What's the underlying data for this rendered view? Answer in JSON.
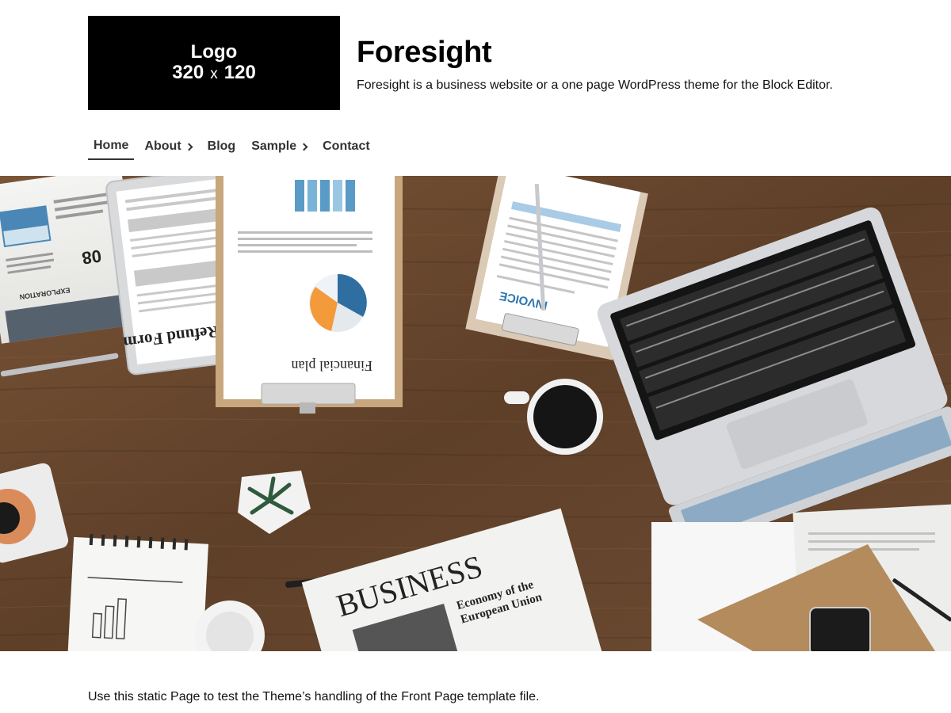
{
  "header": {
    "logo": {
      "line1": "Logo",
      "width_label": "320",
      "times": "x",
      "height_label": "120"
    },
    "title": "Foresight",
    "tagline": "Foresight is a business website or a one page WordPress theme for the Block Editor."
  },
  "nav": {
    "items": [
      {
        "label": "Home",
        "active": true,
        "has_submenu": false
      },
      {
        "label": "About",
        "active": false,
        "has_submenu": true
      },
      {
        "label": "Blog",
        "active": false,
        "has_submenu": false
      },
      {
        "label": "Sample",
        "active": false,
        "has_submenu": true
      },
      {
        "label": "Contact",
        "active": false,
        "has_submenu": false
      }
    ]
  },
  "hero": {
    "image_text": {
      "tax_form": "Tax Refund Form",
      "financial_plan": "Financial plan",
      "invoice": "INVOICE",
      "newspaper_headline": "BUSINESS",
      "newspaper_subhead_1": "Economy of the",
      "newspaper_subhead_2": "European Union",
      "newspaper_left": "EXPLORATION"
    }
  },
  "content": {
    "intro": "Use this static Page to test the Theme’s handling of the Front Page template file."
  }
}
